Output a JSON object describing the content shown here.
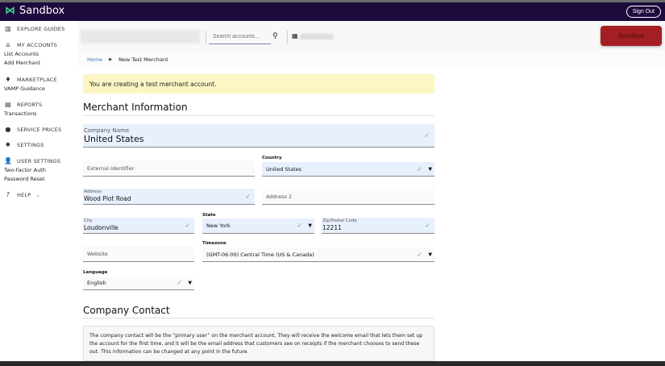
{
  "app": {
    "title": "Sandbox",
    "sign_out": "Sign Out",
    "environment_button": "Sandbox"
  },
  "sidebar": {
    "sections": [
      {
        "label": "EXPLORE GUIDES",
        "icon": "book-icon",
        "items": []
      },
      {
        "label": "MY ACCOUNTS",
        "icon": "store-icon",
        "items": [
          "List Accounts",
          "Add Merchant"
        ]
      },
      {
        "label": "MARKETPLACE",
        "icon": "plug-icon",
        "items": [
          "VAMP Guidance"
        ]
      },
      {
        "label": "REPORTS",
        "icon": "chart-icon",
        "items": [
          "Transactions"
        ]
      },
      {
        "label": "SERVICE PRICES",
        "icon": "dollar-icon",
        "items": []
      },
      {
        "label": "SETTINGS",
        "icon": "gear-icon",
        "items": []
      },
      {
        "label": "USER SETTINGS",
        "icon": "user-lock-icon",
        "items": [
          "Two-Factor Auth",
          "Password Reset"
        ]
      },
      {
        "label": "HELP",
        "icon": "question-icon",
        "items": []
      }
    ]
  },
  "header": {
    "search_placeholder": "Search accounts..."
  },
  "breadcrumb": {
    "home": "Home",
    "current": "New Test Merchant"
  },
  "alert": "You are creating a test merchant account.",
  "merchant": {
    "heading": "Merchant Information",
    "company_name_label": "Company Name",
    "company_name": "United States",
    "external_id_placeholder": "External Identifier",
    "country_label": "Country",
    "country": "United States",
    "address_label": "Address",
    "address": "Wood Plot Road",
    "address2_placeholder": "Address 2",
    "city_label": "City",
    "city": "Loudonville",
    "state_label": "State",
    "state": "New York",
    "zip_label": "Zip/Postal Code",
    "zip": "12211",
    "website_placeholder": "Website",
    "timezone_label": "Timezone",
    "timezone": "(GMT-06:00) Central Time (US & Canada)",
    "language_label": "Language",
    "language": "English"
  },
  "contact": {
    "heading": "Company Contact",
    "info": "The company contact will be the “primary user” on the merchant account. They will receive the welcome email that lets them set up the account for the first time, and it will be the email address that customers see on receipts if the merchant chooses to send these out. This information can be changed at any point in the future."
  }
}
